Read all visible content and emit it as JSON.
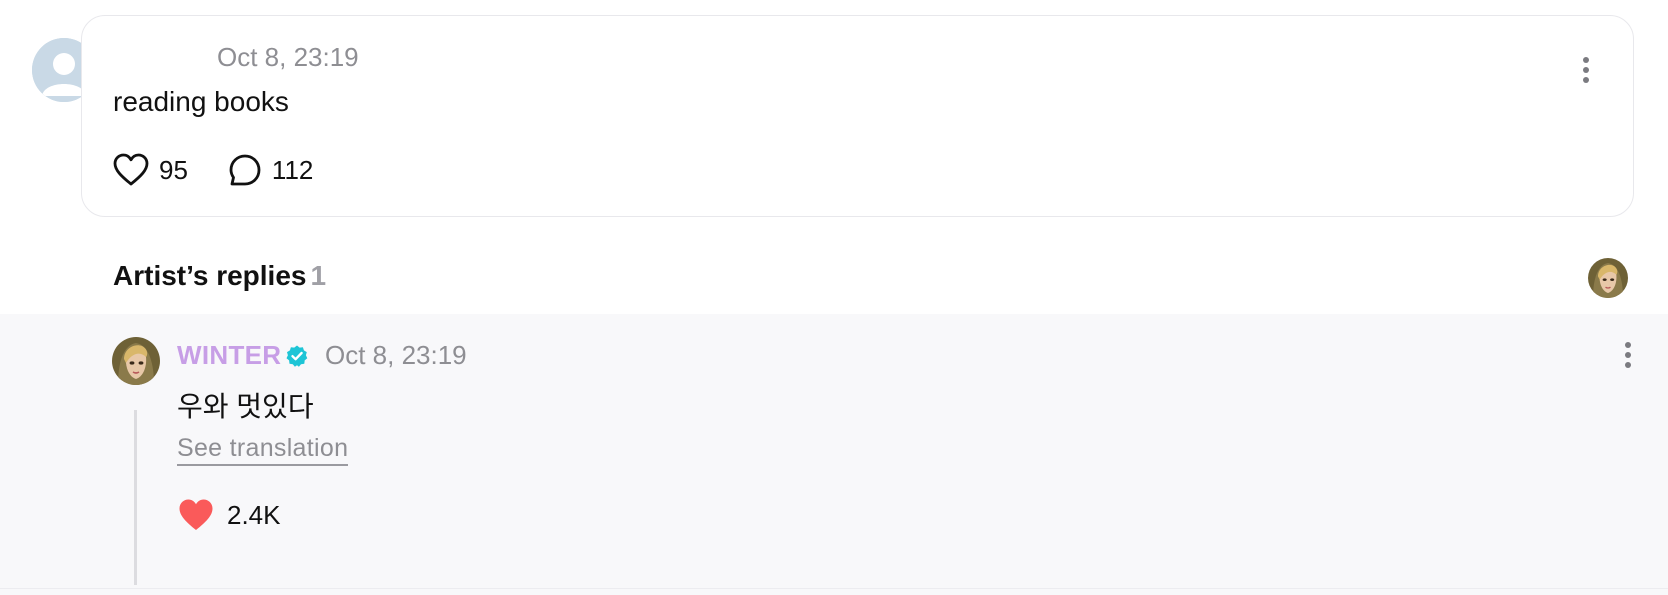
{
  "post": {
    "timestamp": "Oct 8, 23:19",
    "text": "reading books",
    "likes": "95",
    "comments": "112",
    "like_icon": "heart-outline-icon",
    "comment_icon": "speech-bubble-icon"
  },
  "artist_replies": {
    "heading": "Artist’s replies",
    "count": "1"
  },
  "reply": {
    "author": "WINTER",
    "verified": true,
    "timestamp": "Oct 8, 23:19",
    "text": "우와 멋있다",
    "translate_label": "See translation",
    "likes": "2.4K",
    "like_icon": "heart-filled-icon"
  },
  "colors": {
    "artist_name": "#c79ee6",
    "verified_badge": "#1ec5d6",
    "liked_heart": "#fa5a5a",
    "reply_background": "#f8f8fa",
    "card_border": "#e8e8ec"
  }
}
